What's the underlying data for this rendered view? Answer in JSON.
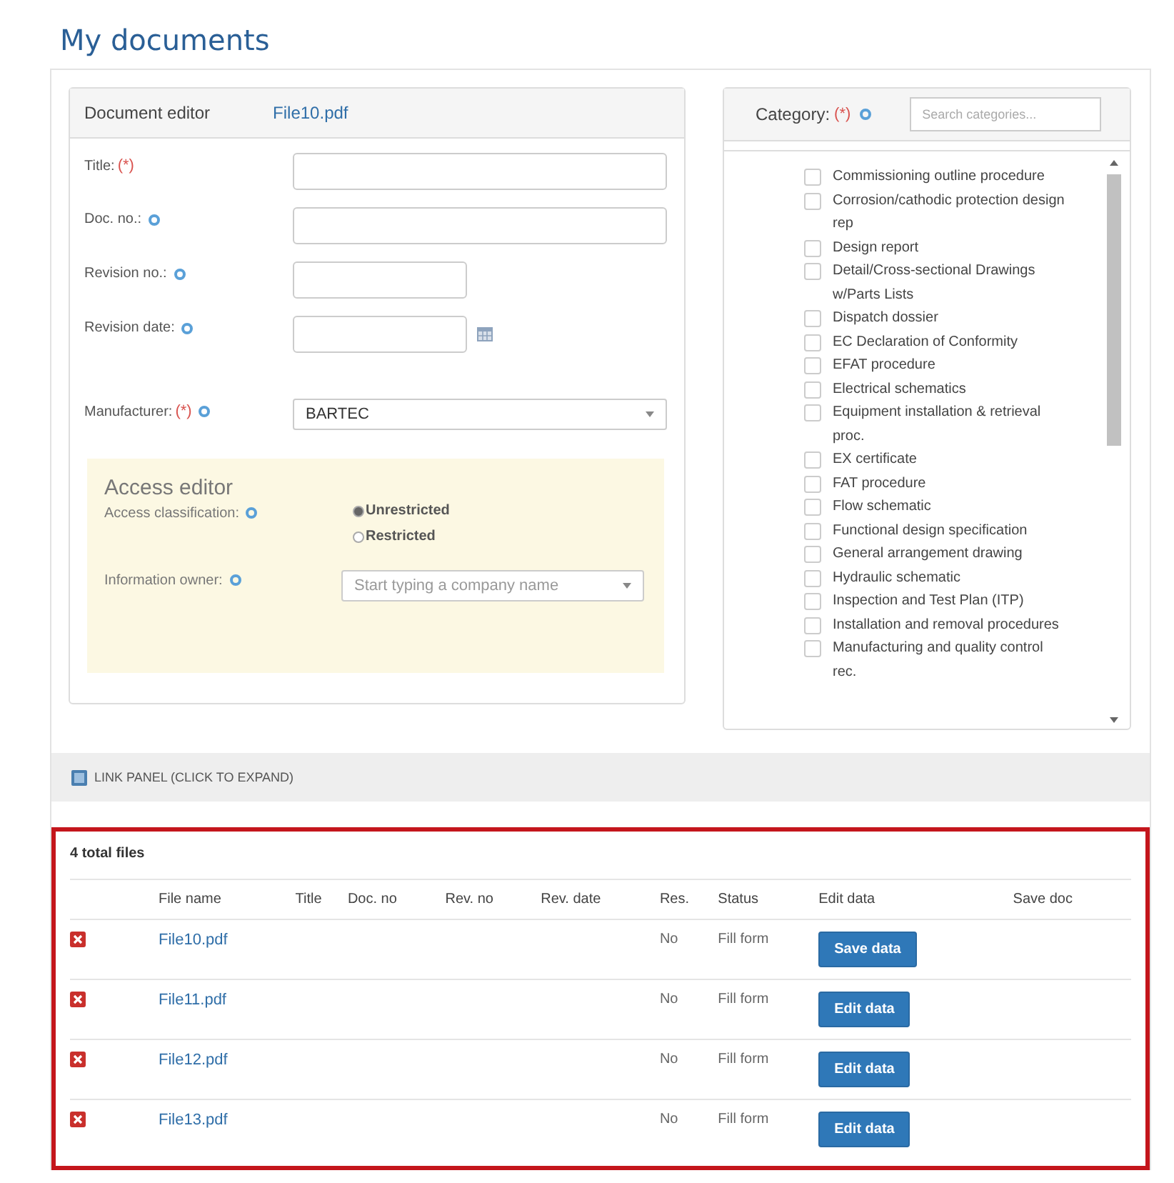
{
  "page_title": "My documents",
  "document_editor": {
    "title": "Document editor",
    "file": "File10.pdf",
    "fields": [
      {
        "label": "Title:",
        "required_mark": "(*)",
        "info": false,
        "kind": "text"
      },
      {
        "label": "Doc. no.:",
        "info": true,
        "kind": "text"
      },
      {
        "label": "Revision no.:",
        "info": true,
        "kind": "short"
      },
      {
        "label": "Revision date:",
        "info": true,
        "kind": "date"
      },
      {
        "label": "Manufacturer:",
        "required_mark": "(*)",
        "info": true,
        "kind": "select",
        "value": "BARTEC"
      }
    ],
    "access_editor": {
      "title": "Access editor",
      "classification_label": "Access classification:",
      "options": [
        {
          "label": "Unrestricted",
          "selected": true
        },
        {
          "label": "Restricted",
          "selected": false
        }
      ],
      "owner_label": "Information owner:",
      "owner_placeholder": "Start typing a company name"
    }
  },
  "category": {
    "label": "Category:",
    "required_mark": "(*)",
    "search_placeholder": "Search categories...",
    "items": [
      {
        "label": "Commissioning outline procedure",
        "checked": false
      },
      {
        "label": "Corrosion/cathodic protection design rep",
        "checked": false
      },
      {
        "label": "Design report",
        "checked": false
      },
      {
        "label": "Detail/Cross-sectional Drawings w/Parts Lists",
        "checked": false
      },
      {
        "label": "Dispatch dossier",
        "checked": false
      },
      {
        "label": "EC Declaration of Conformity",
        "checked": false
      },
      {
        "label": "EFAT procedure",
        "checked": false
      },
      {
        "label": "Electrical schematics",
        "checked": false
      },
      {
        "label": "Equipment installation & retrieval proc.",
        "checked": false
      },
      {
        "label": "EX certificate",
        "checked": false
      },
      {
        "label": "FAT procedure",
        "checked": false
      },
      {
        "label": "Flow schematic",
        "checked": false
      },
      {
        "label": "Functional design specification",
        "checked": false
      },
      {
        "label": "General arrangement drawing",
        "checked": false
      },
      {
        "label": "Hydraulic schematic",
        "checked": false
      },
      {
        "label": "Inspection and Test Plan (ITP)",
        "checked": false
      },
      {
        "label": "Installation and removal procedures",
        "checked": false
      },
      {
        "label": "Manufacturing and quality control rec.",
        "checked": false
      }
    ]
  },
  "link_panel": {
    "label": "LINK PANEL (CLICK TO EXPAND)"
  },
  "files": {
    "total": "4 total files",
    "columns": [
      "File name",
      "Title",
      "Doc. no",
      "Rev. no",
      "Rev. date",
      "Res.",
      "Status",
      "Edit data",
      "Save doc"
    ],
    "rows": [
      {
        "file": "File10.pdf",
        "res": "No",
        "status": "Fill form",
        "button": "Save data"
      },
      {
        "file": "File11.pdf",
        "res": "No",
        "status": "Fill form",
        "button": "Edit data"
      },
      {
        "file": "File12.pdf",
        "res": "No",
        "status": "Fill form",
        "button": "Edit data"
      },
      {
        "file": "File13.pdf",
        "res": "No",
        "status": "Fill form",
        "button": "Edit data"
      }
    ]
  }
}
